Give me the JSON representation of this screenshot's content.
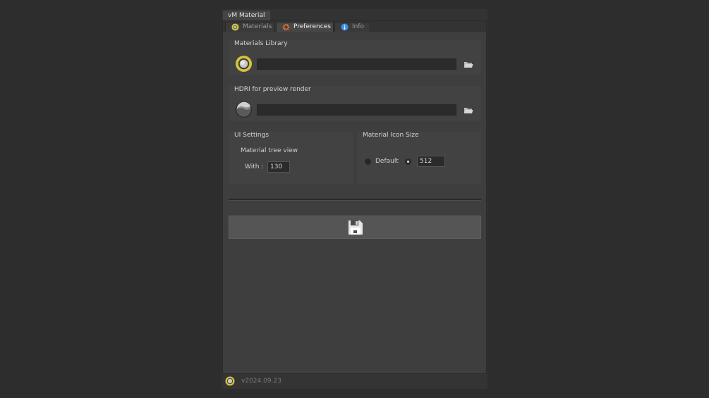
{
  "window": {
    "title": "vM Material"
  },
  "tabs": [
    {
      "label": "Materials",
      "icon": "material-ball-icon",
      "active": false
    },
    {
      "label": "Preferences",
      "icon": "gear-icon",
      "active": true
    },
    {
      "label": "Info",
      "icon": "info-icon",
      "active": false
    }
  ],
  "materials_library": {
    "title": "Materials Library",
    "path": "",
    "icon": "material-ball-icon",
    "browse_icon": "folder-icon"
  },
  "hdri": {
    "title": "HDRI for preview render",
    "path": "",
    "icon": "hdri-sphere-icon",
    "browse_icon": "folder-icon"
  },
  "ui_settings": {
    "title": "UI Settings",
    "subtitle": "Material tree view",
    "width_label": "With :",
    "width_value": "130"
  },
  "icon_size": {
    "title": "Material Icon Size",
    "default_label": "Default",
    "custom_value": "512",
    "selected": "custom"
  },
  "save_button": {
    "icon": "floppy-disk-icon"
  },
  "footer": {
    "version": "v2024.09.23",
    "icon": "material-ball-icon"
  },
  "colors": {
    "accent_yellow": "#d4c23a",
    "background": "#2d2d2d",
    "info_blue": "#3a8ee6"
  }
}
